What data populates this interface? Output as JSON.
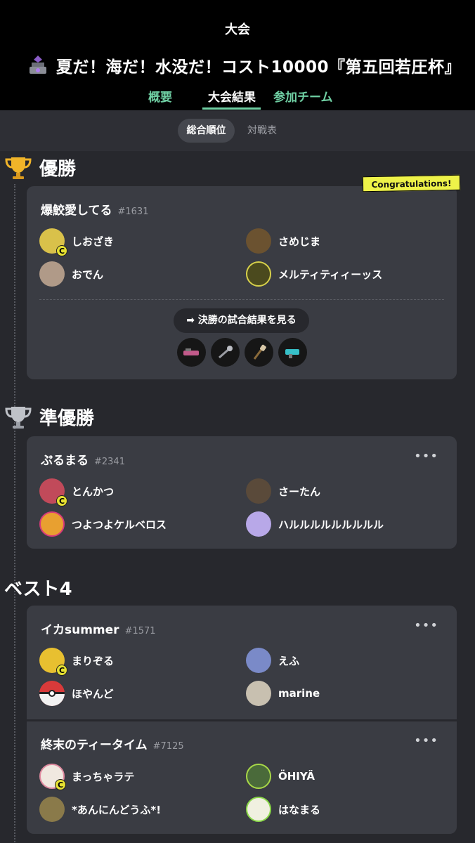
{
  "header": {
    "title": "大会",
    "tournament_name": "夏だ！海だ！水没だ！コスト10000『第五回若圧杯』",
    "tournament_icon": "trophy-box-icon",
    "tabs": [
      {
        "label": "概要",
        "active": false
      },
      {
        "label": "大会結果",
        "active": true
      },
      {
        "label": "参加チーム",
        "active": false
      }
    ]
  },
  "subtabs": [
    {
      "label": "総合順位",
      "active": true
    },
    {
      "label": "対戦表",
      "active": false
    }
  ],
  "colors": {
    "accent": "#6fcfa3",
    "badge": "#e6e132",
    "congrats": "#eef249"
  },
  "sections": {
    "winner": {
      "title": "優勝",
      "congrats_label": "Congratulations!",
      "final_button_label": "決勝の試合結果を見る",
      "weapons": [
        "weapon-1-icon",
        "weapon-2-icon",
        "weapon-3-icon",
        "weapon-4-icon"
      ],
      "team": {
        "name": "爆鮫愛してる",
        "id": "#1631",
        "members": [
          "しおざき",
          "さめじま",
          "おでん",
          "メルティティィーッス"
        ],
        "captain_badge": "C"
      }
    },
    "runner_up": {
      "title": "準優勝",
      "team": {
        "name": "ぷるまる",
        "id": "#2341",
        "members": [
          "とんかつ",
          "さーたん",
          "つよつよケルベロス",
          "ハルルルルルルルルル"
        ],
        "captain_badge": "C"
      }
    },
    "best4": {
      "title": "ベスト4",
      "teams": [
        {
          "name": "イカsummer",
          "id": "#1571",
          "members": [
            "まりぞる",
            "えふ",
            "ほやんど",
            "marine"
          ],
          "captain_badge": "C"
        },
        {
          "name": "終末のティータイム",
          "id": "#7125",
          "members": [
            "まっちゃラテ",
            "ÖHIYÄ",
            "*あんにんどうふ*!",
            "はなまる"
          ],
          "captain_badge": "C"
        }
      ]
    }
  },
  "more_label": "•••"
}
